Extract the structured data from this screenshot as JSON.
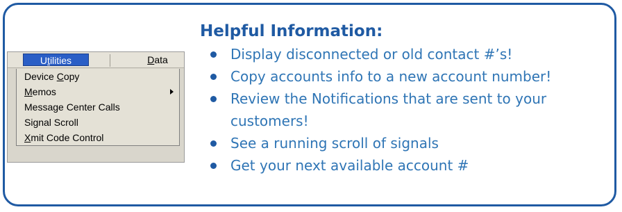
{
  "menu": {
    "bar": {
      "utilities": "Utilities",
      "data": "Data"
    },
    "items": [
      {
        "pre": "Device ",
        "key": "C",
        "post": "opy",
        "submenu": false
      },
      {
        "pre": "",
        "key": "M",
        "post": "emos",
        "submenu": true
      },
      {
        "pre": "Message Center Calls",
        "key": "",
        "post": "",
        "submenu": false
      },
      {
        "pre": "Signal Scroll",
        "key": "",
        "post": "",
        "submenu": false
      },
      {
        "pre": "",
        "key": "X",
        "post": "mit Code Control",
        "submenu": false
      }
    ],
    "bar_keys": {
      "utilities_key": "t",
      "data_key": "D"
    }
  },
  "info": {
    "title": "Helpful Information:",
    "items": [
      "Display disconnected or old contact #’s!",
      "Copy accounts info to a new account number!",
      "Review the Notifications that are sent to your customers!",
      "See a running scroll of signals",
      "Get your next available account #"
    ]
  },
  "colors": {
    "border": "#1f5aa3",
    "text_blue": "#2f75b5",
    "menu_highlight": "#2a5ec6"
  }
}
